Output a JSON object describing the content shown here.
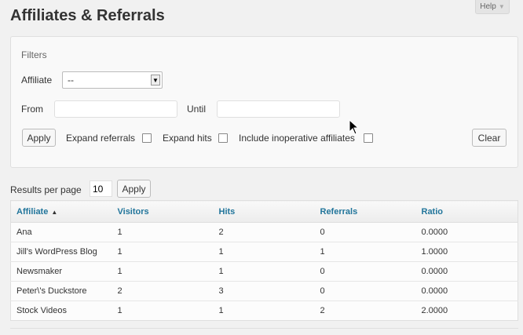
{
  "help": {
    "label": "Help",
    "arrow": "▼"
  },
  "page": {
    "title": "Affiliates & Referrals"
  },
  "filters": {
    "heading": "Filters",
    "affiliate_label": "Affiliate",
    "affiliate_value": "--",
    "from_label": "From",
    "from_value": "",
    "until_label": "Until",
    "until_value": "",
    "apply_label": "Apply",
    "expand_referrals_label": "Expand referrals",
    "expand_hits_label": "Expand hits",
    "include_inoperative_label": "Include inoperative affiliates",
    "clear_label": "Clear"
  },
  "pagination": {
    "results_per_page_label": "Results per page",
    "results_per_page_value": "10",
    "apply_label": "Apply"
  },
  "table": {
    "columns": [
      "Affiliate",
      "Visitors",
      "Hits",
      "Referrals",
      "Ratio"
    ],
    "sort_indicator": "▲",
    "rows": [
      [
        "Ana",
        "1",
        "2",
        "0",
        "0.0000"
      ],
      [
        "Jill's WordPress Blog",
        "1",
        "1",
        "1",
        "1.0000"
      ],
      [
        "Newsmaker",
        "1",
        "1",
        "0",
        "0.0000"
      ],
      [
        "Peter\\'s Duckstore",
        "2",
        "3",
        "0",
        "0.0000"
      ],
      [
        "Stock Videos",
        "1",
        "1",
        "2",
        "2.0000"
      ]
    ]
  }
}
